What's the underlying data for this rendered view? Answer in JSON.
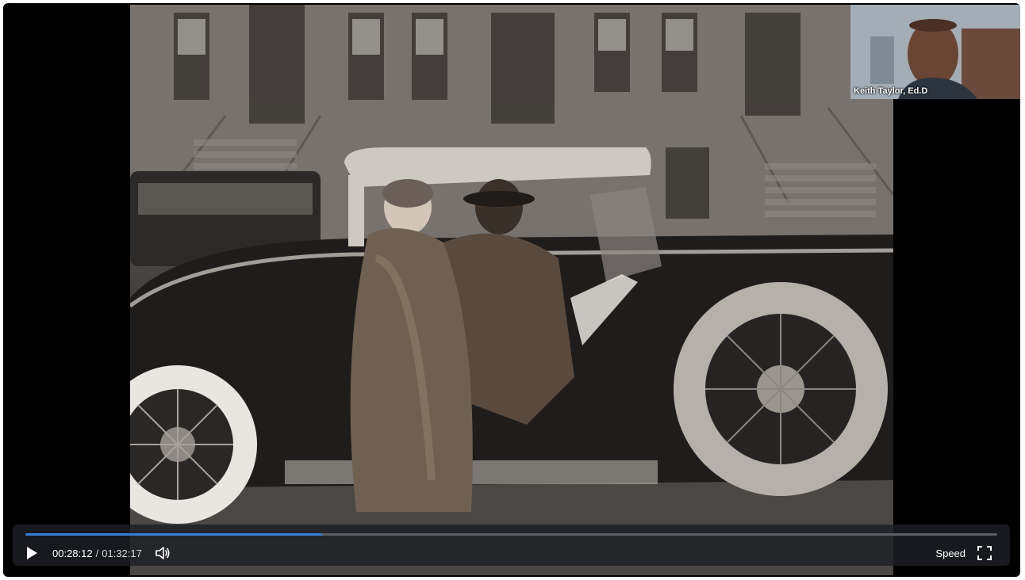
{
  "webcam": {
    "participant_name": "Keith Taylor, Ed.D"
  },
  "controls": {
    "current_time": "00:28:12",
    "separator": "/",
    "total_time": "01:32:17",
    "progress_fraction": 0.305,
    "speed_label": "Speed"
  },
  "icons": {
    "play": "play-icon",
    "volume": "volume-icon",
    "fullscreen": "fullscreen-icon"
  },
  "colors": {
    "progress": "#3a7bd5",
    "track": "#5b5f66",
    "background": "#000000"
  }
}
